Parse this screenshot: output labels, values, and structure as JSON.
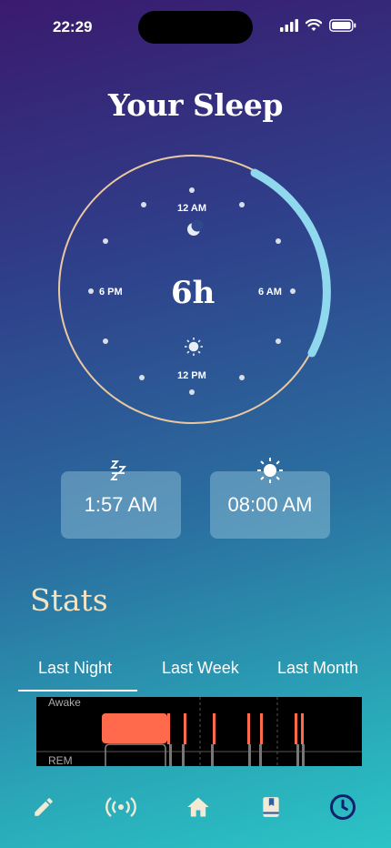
{
  "status": {
    "time": "22:29"
  },
  "header": {
    "title": "Your Sleep"
  },
  "clock": {
    "center_label": "6h",
    "labels": {
      "top": "12 AM",
      "bottom": "12 PM",
      "left": "6 PM",
      "right": "6 AM"
    }
  },
  "cards": {
    "bedtime": "1:57 AM",
    "wake": "08:00 AM"
  },
  "stats": {
    "title": "Stats",
    "tabs": [
      "Last Night",
      "Last Week",
      "Last Month"
    ],
    "active_tab": "Last Night"
  },
  "chart": {
    "labels": {
      "top": "Awake",
      "bottom": "REM"
    }
  },
  "nav": [
    "edit-icon",
    "broadcast-icon",
    "home-icon",
    "book-icon",
    "clock-icon"
  ],
  "colors": {
    "accent_arc": "#8fd8ee",
    "ring": "#e9c9a0",
    "sleep_bar": "#ff6a4d",
    "nav_active": "#13206b"
  }
}
